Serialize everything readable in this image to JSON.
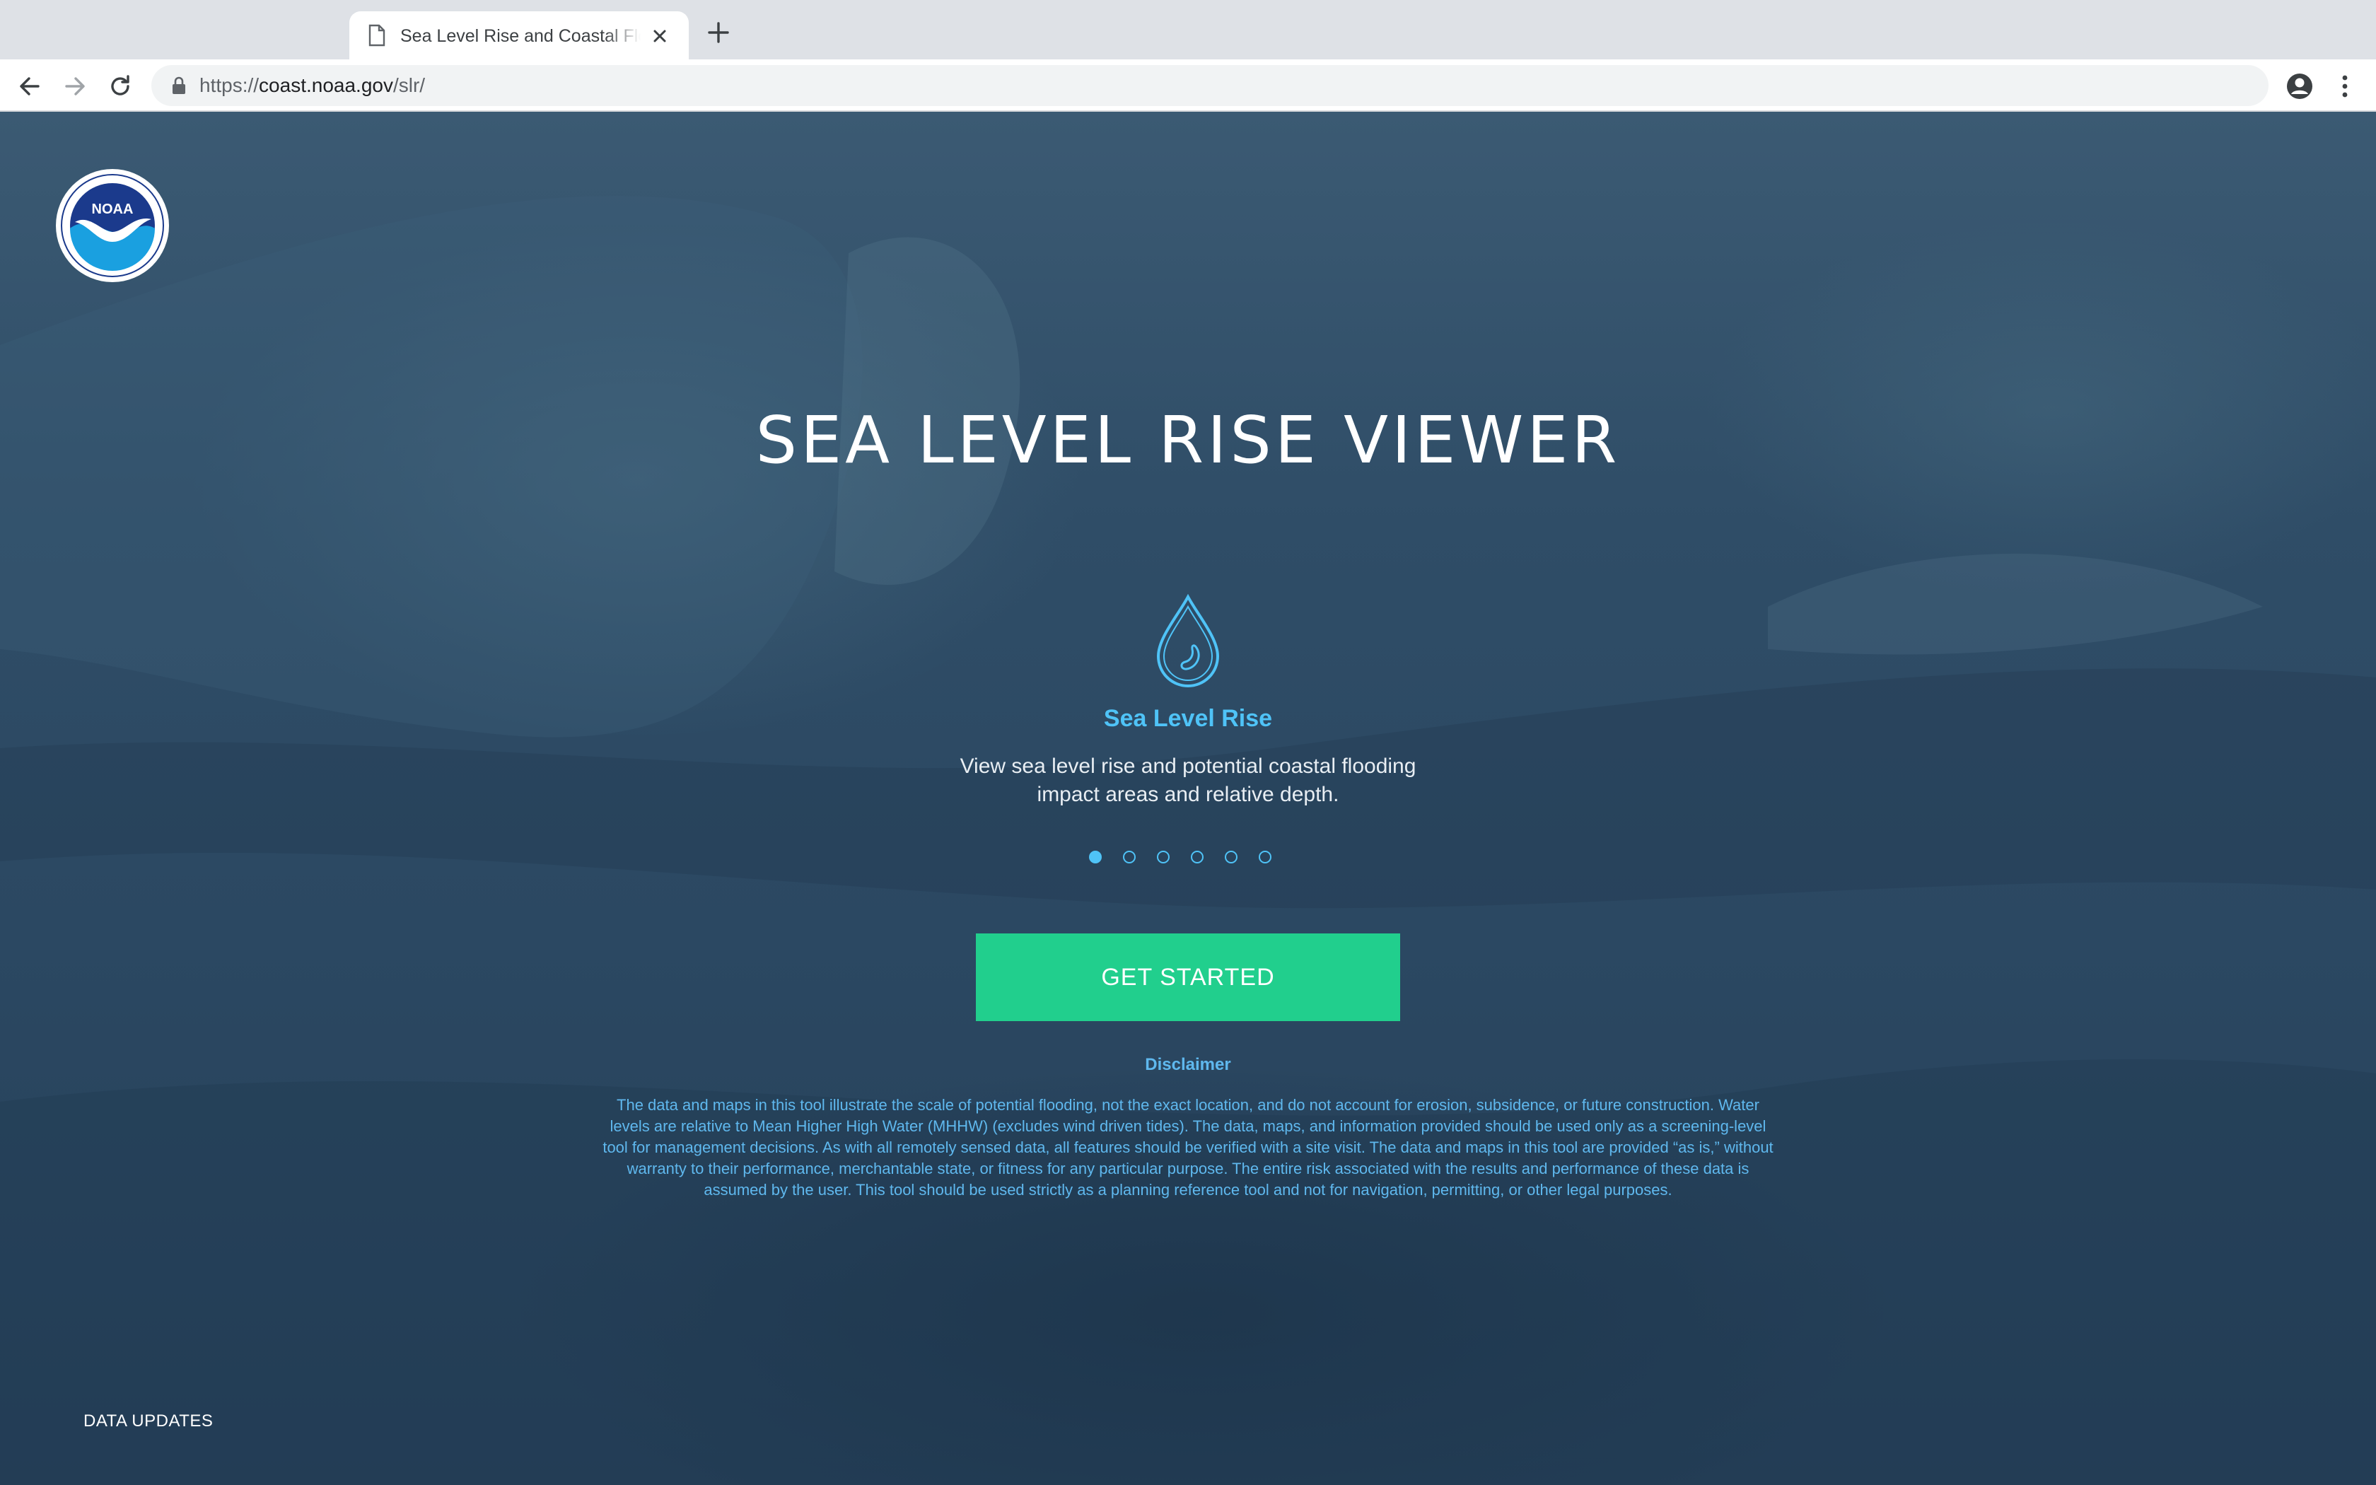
{
  "browser": {
    "tab_title": "Sea Level Rise and Coastal Flooding Impacts",
    "url_prefix": "https://",
    "url_host": "coast.noaa.gov",
    "url_path": "/slr/"
  },
  "page": {
    "title": "SEA LEVEL RISE VIEWER",
    "logo_text": "NOAA",
    "slide": {
      "title": "Sea Level Rise",
      "description": "View sea level rise and potential coastal flooding impact areas and relative depth.",
      "icon": "water-drop-icon",
      "count": 6,
      "active_index": 0
    },
    "cta_label": "GET STARTED",
    "disclaimer_title": "Disclaimer",
    "disclaimer_text": "The data and maps in this tool illustrate the scale of potential flooding, not the exact location, and do not account for erosion, subsidence, or future construction. Water levels are relative to Mean Higher High Water (MHHW) (excludes wind driven tides). The data, maps, and information provided should be used only as a screening-level tool for management decisions. As with all remotely sensed data, all features should be verified with a site visit. The data and maps in this tool are provided “as is,” without warranty to their performance, merchantable state, or fitness for any particular purpose. The entire risk associated with the results and performance of these data is assumed by the user. This tool should be used strictly as a planning reference tool and not for navigation, permitting, or other legal purposes.",
    "footer_link": "DATA UPDATES"
  },
  "colors": {
    "accent_blue": "#4fc3f7",
    "cta_green": "#21cf8d",
    "disclaimer_blue": "#5fb8ee",
    "background": "#2b4862"
  }
}
